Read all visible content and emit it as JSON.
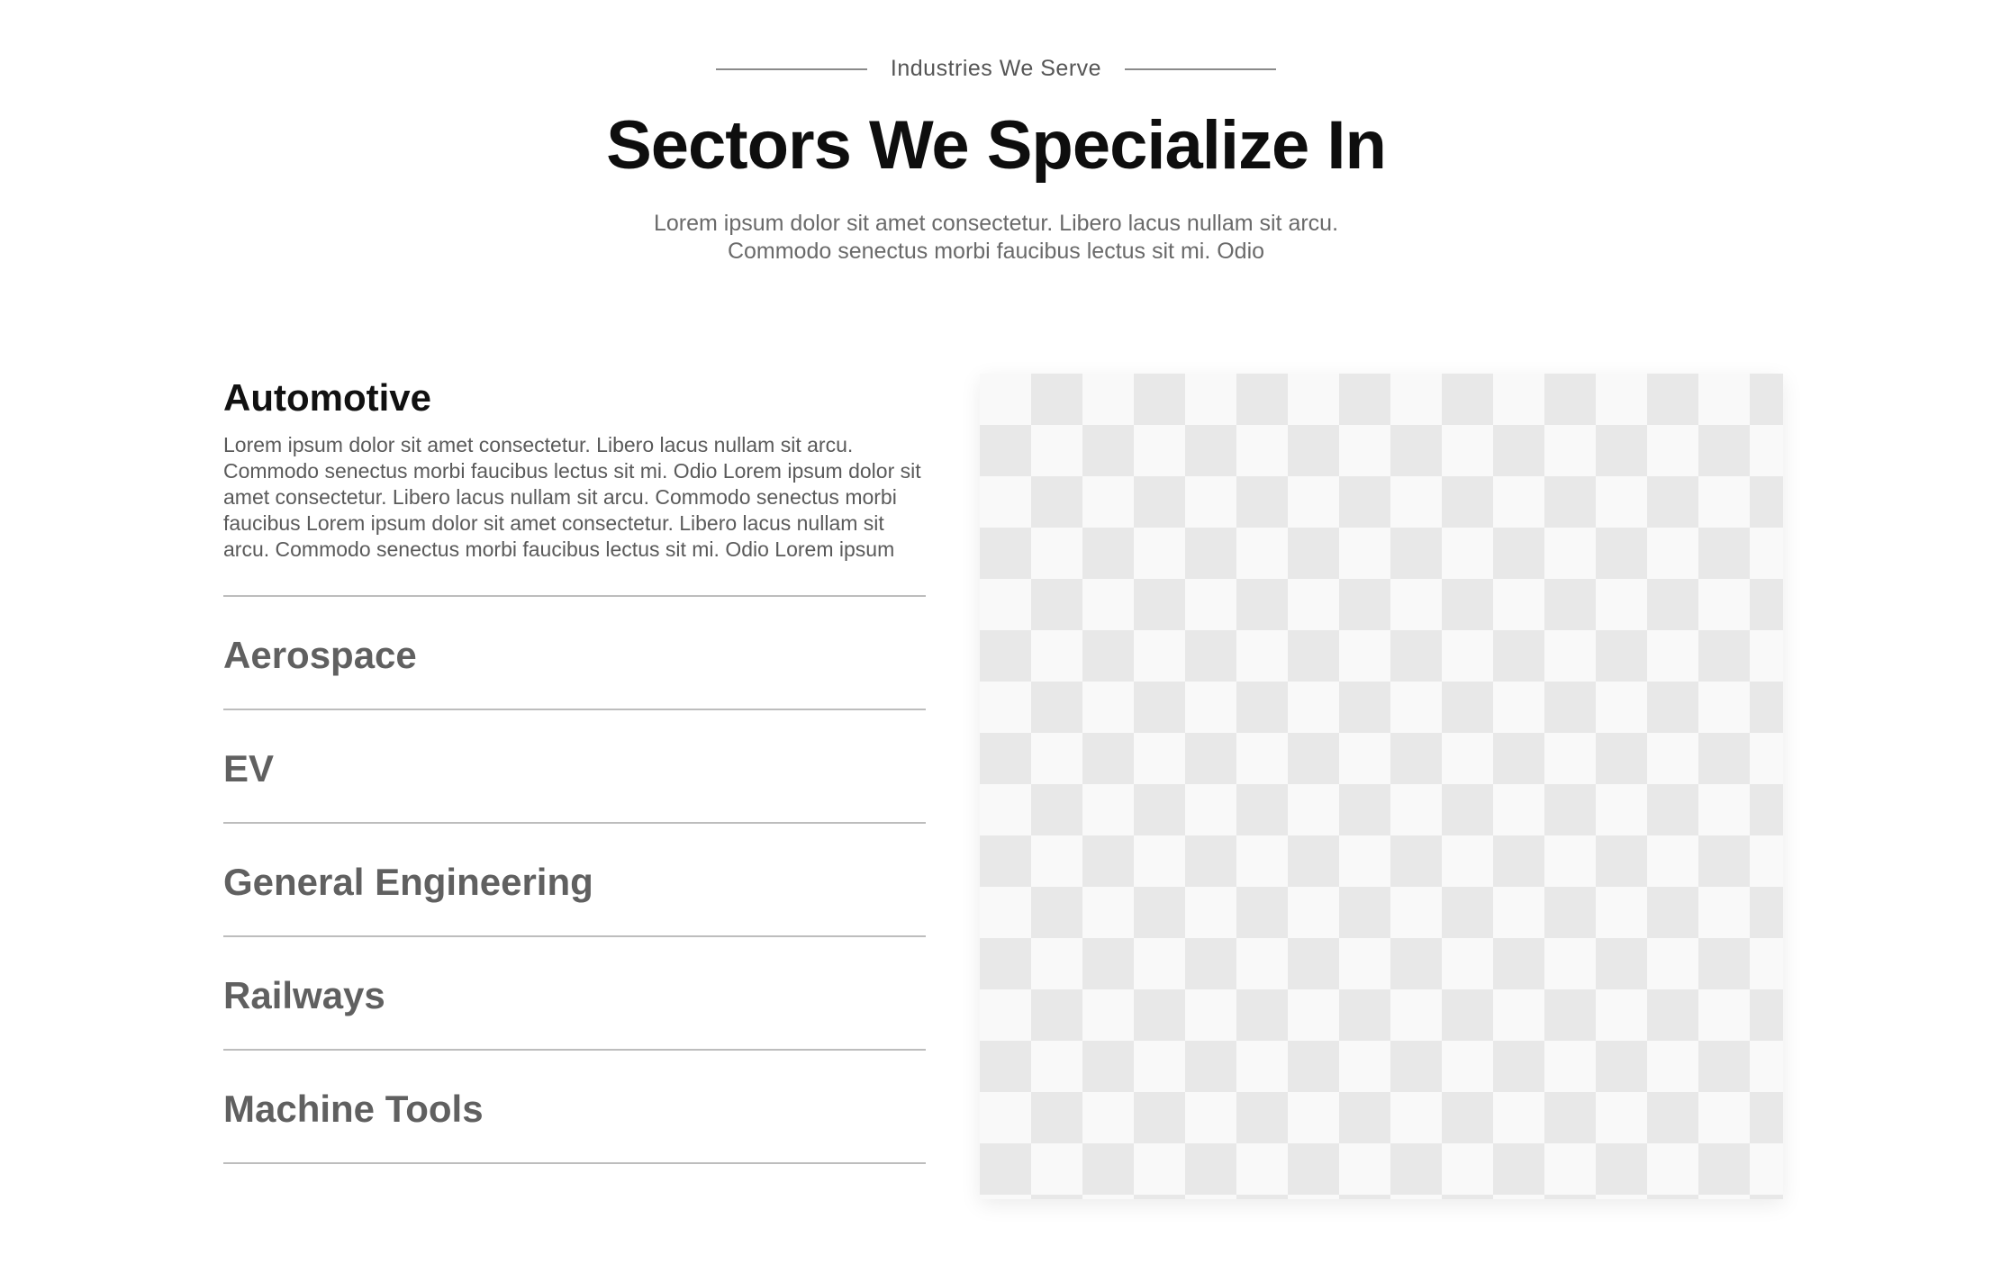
{
  "header": {
    "eyebrow": "Industries We Serve",
    "title": "Sectors We Specialize In",
    "intro_line1": "Lorem ipsum dolor sit amet consectetur. Libero lacus nullam sit arcu.",
    "intro_line2": "Commodo senectus morbi faucibus lectus sit mi. Odio"
  },
  "sectors": {
    "active": {
      "title": "Automotive",
      "description": "Lorem ipsum dolor sit amet consectetur. Libero lacus nullam sit arcu. Commodo senectus morbi faucibus lectus sit mi. Odio Lorem ipsum dolor sit amet consectetur. Libero lacus nullam sit arcu. Commodo senectus morbi faucibus Lorem ipsum dolor sit amet consectetur. Libero lacus nullam sit arcu. Commodo senectus morbi faucibus lectus sit mi. Odio Lorem ipsum"
    },
    "items": [
      {
        "title": "Aerospace"
      },
      {
        "title": "EV"
      },
      {
        "title": "General Engineering"
      },
      {
        "title": "Railways"
      },
      {
        "title": "Machine Tools"
      }
    ]
  },
  "image": {
    "icon": "image-placeholder-icon"
  }
}
